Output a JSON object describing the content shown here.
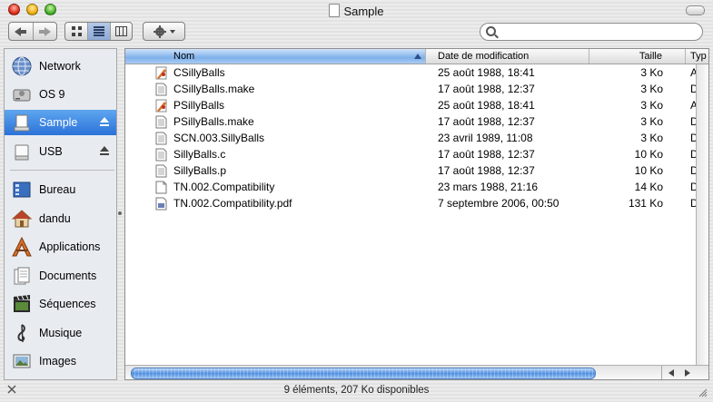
{
  "window": {
    "title": "Sample"
  },
  "toolbar": {
    "search_placeholder": ""
  },
  "sidebar": {
    "devices": [
      {
        "label": "Network",
        "icon": "globe-icon"
      },
      {
        "label": "OS 9",
        "icon": "hard-disk-icon"
      },
      {
        "label": "Sample",
        "icon": "disk-image-icon",
        "selected": true,
        "eject": true
      },
      {
        "label": "USB",
        "icon": "usb-drive-icon",
        "eject": true
      }
    ],
    "places": [
      {
        "label": "Bureau",
        "icon": "desktop-icon"
      },
      {
        "label": "dandu",
        "icon": "home-icon"
      },
      {
        "label": "Applications",
        "icon": "applications-icon"
      },
      {
        "label": "Documents",
        "icon": "documents-icon"
      },
      {
        "label": "Séquences",
        "icon": "movies-icon"
      },
      {
        "label": "Musique",
        "icon": "music-icon"
      },
      {
        "label": "Images",
        "icon": "pictures-icon"
      }
    ]
  },
  "list": {
    "columns": {
      "name": "Nom",
      "date": "Date de modification",
      "size": "Taille",
      "kind": "Typ"
    },
    "rows": [
      {
        "name": "CSillyBalls",
        "date": "25 août 1988, 18:41",
        "size": "3 Ko",
        "kind": "A",
        "icon": "application-icon"
      },
      {
        "name": "CSillyBalls.make",
        "date": "17 août 1988, 12:37",
        "size": "3 Ko",
        "kind": "D",
        "icon": "text-document-icon"
      },
      {
        "name": "PSillyBalls",
        "date": "25 août 1988, 18:41",
        "size": "3 Ko",
        "kind": "A",
        "icon": "application-icon"
      },
      {
        "name": "PSillyBalls.make",
        "date": "17 août 1988, 12:37",
        "size": "3 Ko",
        "kind": "D",
        "icon": "text-document-icon"
      },
      {
        "name": "SCN.003.SillyBalls",
        "date": "23 avril 1989, 11:08",
        "size": "3 Ko",
        "kind": "D",
        "icon": "text-document-icon"
      },
      {
        "name": "SillyBalls.c",
        "date": "17 août 1988, 12:37",
        "size": "10 Ko",
        "kind": "D",
        "icon": "text-document-icon"
      },
      {
        "name": "SillyBalls.p",
        "date": "17 août 1988, 12:37",
        "size": "10 Ko",
        "kind": "D",
        "icon": "text-document-icon"
      },
      {
        "name": "TN.002.Compatibility",
        "date": "23 mars 1988, 21:16",
        "size": "14 Ko",
        "kind": "D",
        "icon": "blank-document-icon"
      },
      {
        "name": "TN.002.Compatibility.pdf",
        "date": "7 septembre 2006, 00:50",
        "size": "131 Ko",
        "kind": "D",
        "icon": "pdf-document-icon"
      }
    ]
  },
  "statusbar": {
    "text": "9 éléments, 207 Ko disponibles"
  }
}
